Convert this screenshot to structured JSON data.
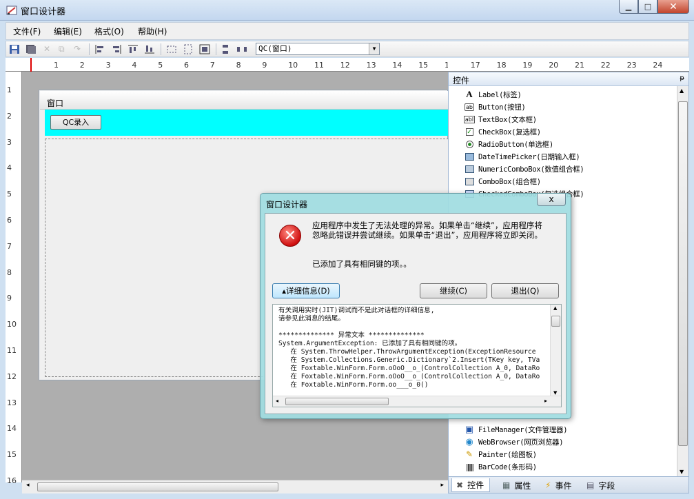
{
  "app": {
    "title": "窗口设计器"
  },
  "menu": {
    "items": [
      "文件(F)",
      "编辑(E)",
      "格式(O)",
      "帮助(H)"
    ]
  },
  "toolbar": {
    "combo_value": "QC(窗口)"
  },
  "ruler": {
    "h_numbers": [
      "1",
      "2",
      "3",
      "4",
      "5",
      "6",
      "7",
      "8",
      "9",
      "10",
      "11",
      "12",
      "13",
      "14",
      "15",
      "16",
      "17",
      "18",
      "19",
      "20",
      "21",
      "22",
      "23",
      "24"
    ],
    "v_numbers": [
      "1",
      "2",
      "3",
      "4",
      "5",
      "6",
      "7",
      "8",
      "9",
      "10",
      "11",
      "12",
      "13",
      "14",
      "15",
      "16"
    ]
  },
  "form": {
    "title": "窗口",
    "qc_button": "QC录入"
  },
  "panel": {
    "title": "控件",
    "items": [
      {
        "label": "Label(标签)",
        "icon": "label-icon"
      },
      {
        "label": "Button(按钮)",
        "icon": "button-icon"
      },
      {
        "label": "TextBox(文本框)",
        "icon": "textbox-icon"
      },
      {
        "label": "CheckBox(复选框)",
        "icon": "checkbox-icon"
      },
      {
        "label": "RadioButton(单选框)",
        "icon": "radio-icon"
      },
      {
        "label": "DateTimePicker(日期输入框)",
        "icon": "datetime-icon"
      },
      {
        "label": "NumericComboBox(数值组合框)",
        "icon": "numeric-combo-icon"
      },
      {
        "label": "ComboBox(组合框)",
        "icon": "combobox-icon"
      },
      {
        "label": "CheckedComboBox(复选组合框)",
        "icon": "checked-combo-icon"
      }
    ],
    "bottom_items": [
      {
        "label": "FileManager(文件管理器)",
        "icon": "file-manager-icon"
      },
      {
        "label": "WebBrowser(网页浏览器)",
        "icon": "web-browser-icon"
      },
      {
        "label": "Painter(绘图板)",
        "icon": "painter-icon"
      },
      {
        "label": "BarCode(条形码)",
        "icon": "barcode-icon"
      }
    ],
    "tabs": [
      "控件",
      "属性",
      "事件",
      "字段"
    ]
  },
  "dialog": {
    "title": "窗口设计器",
    "close": "x",
    "message": "应用程序中发生了无法处理的异常。如果单击“继续”，应用程序将忽略此错误并尝试继续。如果单击“退出”，应用程序将立即关闭。",
    "message2": "已添加了具有相同键的项。。",
    "details_button": "▴详细信息(D)",
    "continue_button": "继续(C)",
    "quit_button": "退出(Q)",
    "details_text": "有关调用实时(JIT)调试而不是此对话框的详细信息,\n请参见此消息的结尾。\n\n************** 异常文本 **************\nSystem.ArgumentException: 已添加了具有相同键的项。\n   在 System.ThrowHelper.ThrowArgumentException(ExceptionResource\n   在 System.Collections.Generic.Dictionary`2.Insert(TKey key, TVa\n   在 Foxtable.WinForm.Form.oOoO__o_(ControlCollection A_0, DataRo\n   在 Foxtable.WinForm.Form.oOoO__o_(ControlCollection A_0, DataRo\n   在 Foxtable.WinForm.Form.oo___o_0()"
  },
  "colors": {
    "accent": "#00ffff",
    "canvas": "#aeaeae"
  }
}
